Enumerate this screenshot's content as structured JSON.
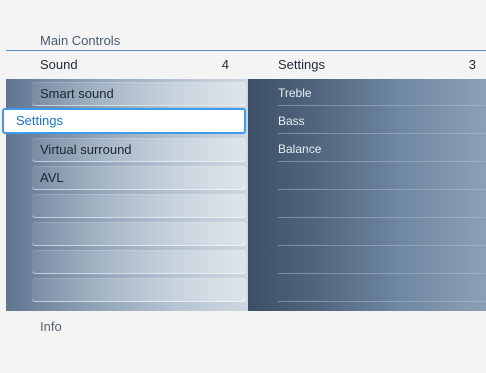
{
  "breadcrumb": "Main Controls",
  "left_column": {
    "title": "Sound",
    "count": "4",
    "items": [
      {
        "label": "Smart sound"
      },
      {
        "label": "Settings"
      },
      {
        "label": "Virtual surround"
      },
      {
        "label": "AVL"
      }
    ],
    "selected_label": "Settings"
  },
  "right_column": {
    "title": "Settings",
    "count": "3",
    "items": [
      {
        "label": "Treble"
      },
      {
        "label": "Bass"
      },
      {
        "label": "Balance"
      }
    ]
  },
  "footer": {
    "info_label": "Info"
  },
  "colors": {
    "accent": "#3d9be9",
    "selected_text": "#1875c9",
    "divider": "#5b8fc0"
  }
}
